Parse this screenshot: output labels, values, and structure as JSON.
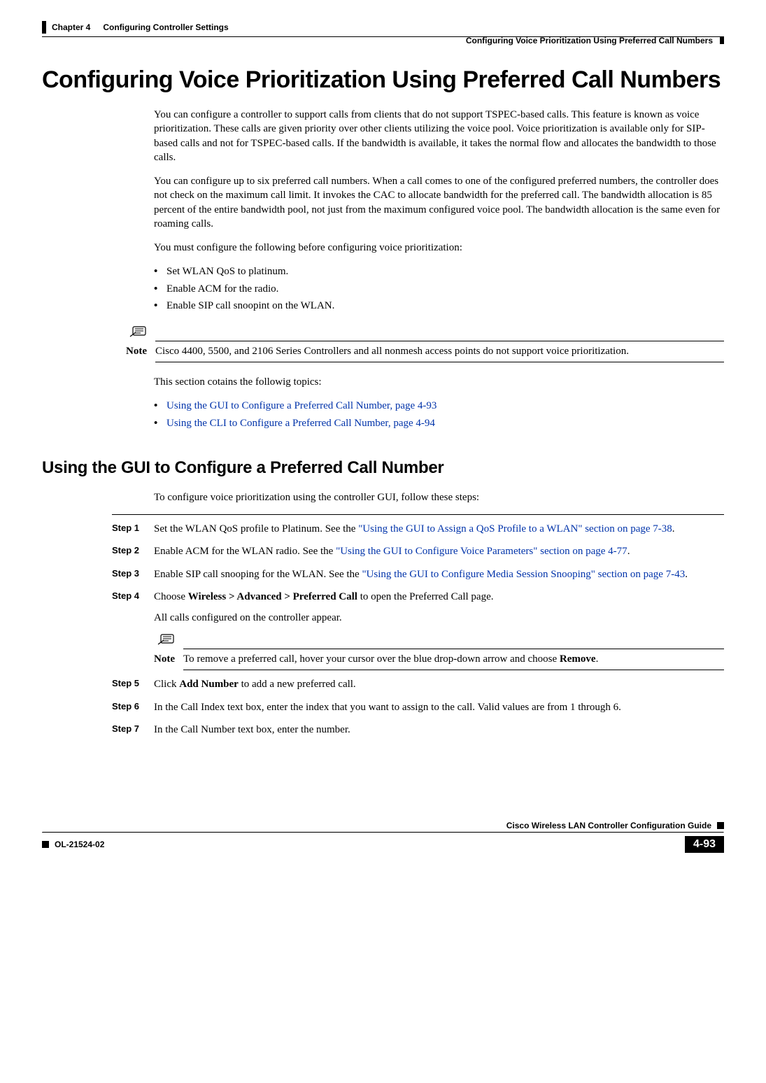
{
  "header": {
    "chapter_label": "Chapter 4",
    "chapter_title": "Configuring Controller Settings",
    "running_head": "Configuring Voice Prioritization Using Preferred Call Numbers"
  },
  "headings": {
    "h1": "Configuring Voice Prioritization Using Preferred Call Numbers",
    "h2": "Using the GUI to Configure a Preferred Call Number"
  },
  "intro": {
    "p1": "You can configure a controller to support calls from clients that do not support TSPEC-based calls. This feature is known as voice prioritization. These calls are given priority over other clients utilizing the voice pool. Voice prioritization is available only for SIP-based calls and not for TSPEC-based calls. If the bandwidth is available, it takes the normal flow and allocates the bandwidth to those calls.",
    "p2": "You can configure up to six preferred call numbers. When a call comes to one of the configured preferred numbers, the controller does not check on the maximum call limit. It invokes the CAC to allocate bandwidth for the preferred call. The bandwidth allocation is 85 percent of the entire bandwidth pool, not just from the maximum configured voice pool. The bandwidth allocation is the same even for roaming calls.",
    "p3": "You must configure the following before configuring voice prioritization:",
    "bullets": [
      "Set WLAN QoS to platinum.",
      "Enable ACM for the radio.",
      "Enable SIP call snoopint on the WLAN."
    ]
  },
  "note1": {
    "label": "Note",
    "text": "Cisco 4400, 5500, and 2106 Series Controllers and all nonmesh access points do not support voice prioritization."
  },
  "topics": {
    "lead": "This section cotains the followig topics:",
    "items": [
      "Using the GUI to Configure a Preferred Call Number, page 4-93",
      "Using the CLI to Configure a Preferred Call Number, page 4-94"
    ]
  },
  "gui_intro": "To configure voice prioritization using the controller GUI, follow these steps:",
  "steps": [
    {
      "num": "Step 1",
      "pre": "Set the WLAN QoS profile to Platinum. See the ",
      "link": "\"Using the GUI to Assign a QoS Profile to a WLAN\" section on page 7-38",
      "post": "."
    },
    {
      "num": "Step 2",
      "pre": "Enable ACM for the WLAN radio. See the ",
      "link": "\"Using the GUI to Configure Voice Parameters\" section on page 4-77",
      "post": "."
    },
    {
      "num": "Step 3",
      "pre": "Enable SIP call snooping for the WLAN. See the ",
      "link": "\"Using the GUI to Configure Media Session Snooping\" section on page 7-43",
      "post": "."
    },
    {
      "num": "Step 4",
      "pre": "Choose ",
      "bold": "Wireless > Advanced > Preferred Call",
      "mid": " to open the Preferred Call page.",
      "sub": "All calls configured on the controller appear."
    }
  ],
  "note2": {
    "label": "Note",
    "pre": "To remove a preferred call, hover your cursor over the blue drop-down arrow and choose ",
    "bold": "Remove",
    "post": "."
  },
  "steps2": [
    {
      "num": "Step 5",
      "pre": "Click ",
      "bold": "Add Number",
      "post": " to add a new preferred call."
    },
    {
      "num": "Step 6",
      "text": "In the Call Index text box, enter the index that you want to assign to the call. Valid values are from 1 through 6."
    },
    {
      "num": "Step 7",
      "text": "In the Call Number text box, enter the number."
    }
  ],
  "footer": {
    "guide_title": "Cisco Wireless LAN Controller Configuration Guide",
    "doc_id": "OL-21524-02",
    "page_num": "4-93"
  }
}
